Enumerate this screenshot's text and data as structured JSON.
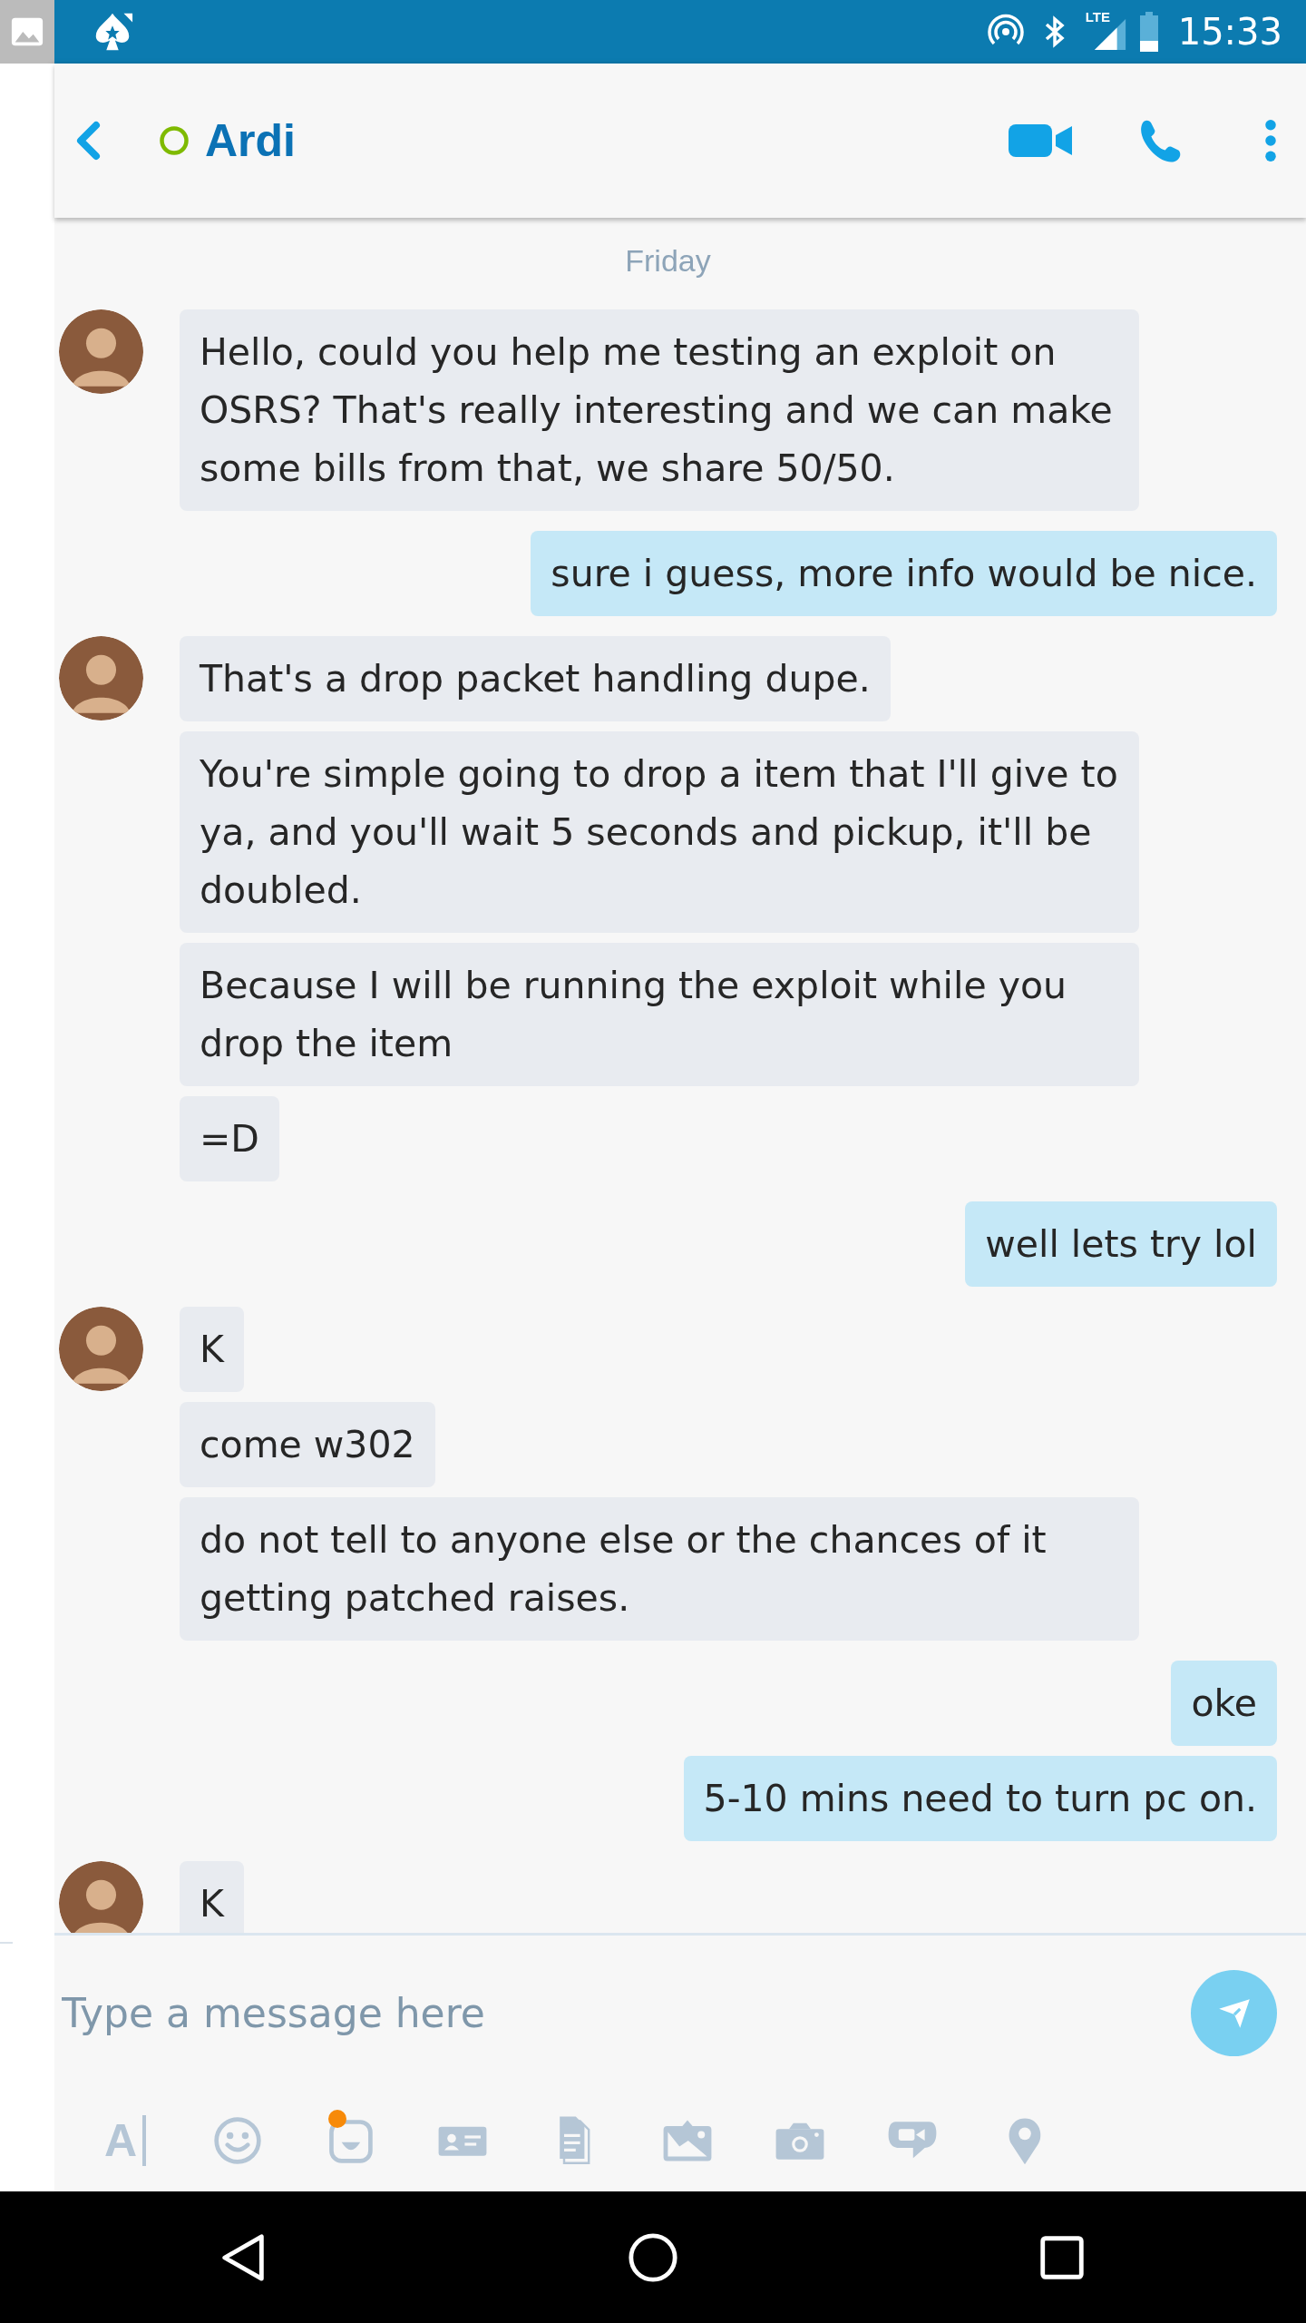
{
  "status_bar": {
    "network": "LTE",
    "time": "15:33"
  },
  "header": {
    "contact": "Ardi",
    "online": false
  },
  "conversation": {
    "day": "Friday",
    "groups": [
      {
        "kind": "incoming",
        "messages": [
          "Hello, could you help me testing an exploit on OSRS? That's really interesting and we can make some bills from that, we share 50/50."
        ]
      },
      {
        "kind": "outgoing",
        "messages": [
          "sure i guess, more info would be nice."
        ]
      },
      {
        "kind": "incoming",
        "messages": [
          "That's a drop packet handling dupe.",
          "You're simple going to drop a item that I'll give to ya, and you'll wait 5 seconds and pickup, it'll be doubled.",
          "Because I will be running the exploit while you drop the item",
          "=D"
        ]
      },
      {
        "kind": "outgoing",
        "messages": [
          "well lets try lol"
        ]
      },
      {
        "kind": "incoming",
        "messages": [
          "K",
          "come w302",
          "do not tell to anyone else or the chances of it getting patched raises."
        ]
      },
      {
        "kind": "outgoing",
        "messages": [
          "oke",
          "5-10 mins need to turn pc on."
        ]
      },
      {
        "kind": "incoming",
        "messages": [
          "K"
        ]
      }
    ]
  },
  "composer": {
    "placeholder": "Type a message here"
  },
  "toolbar": [
    {
      "kind": "text",
      "label": "A",
      "badge": false
    },
    {
      "kind": "emoji",
      "badge": false
    },
    {
      "kind": "sticker",
      "badge": true
    },
    {
      "kind": "contact",
      "badge": false
    },
    {
      "kind": "file",
      "badge": false
    },
    {
      "kind": "photo",
      "badge": false
    },
    {
      "kind": "camera",
      "badge": false
    },
    {
      "kind": "video-message",
      "badge": false
    },
    {
      "kind": "location",
      "badge": false
    }
  ]
}
